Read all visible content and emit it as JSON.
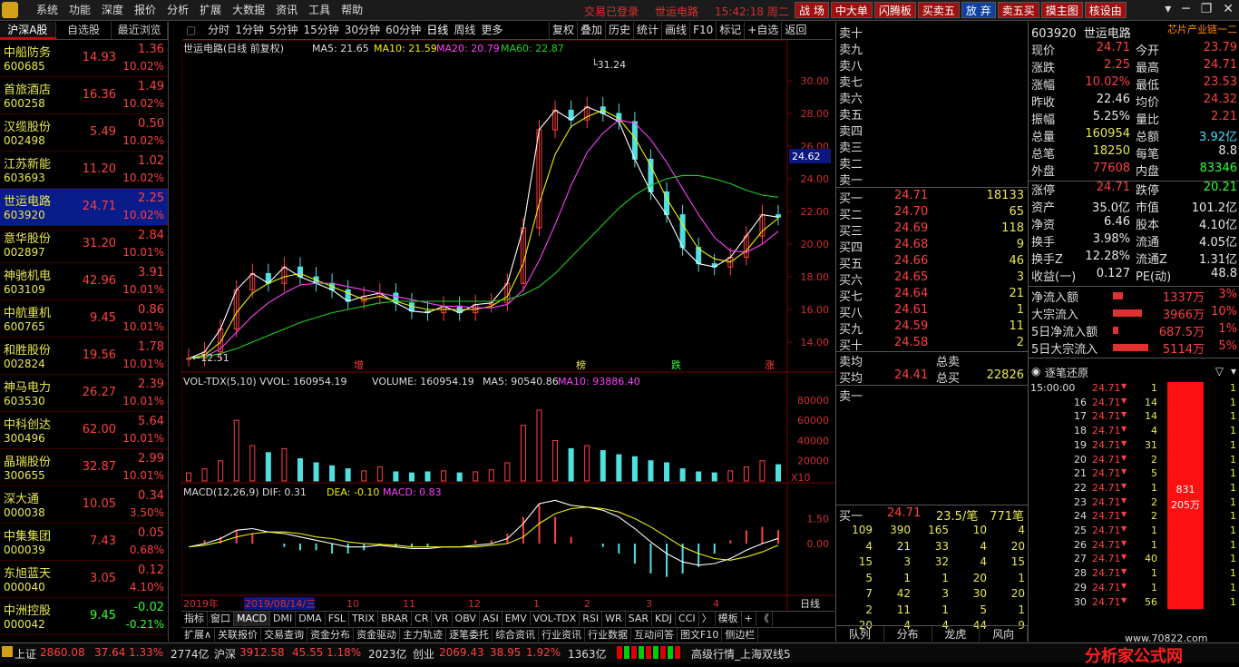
{
  "menu": {
    "items": [
      "系统",
      "功能",
      "深度",
      "报价",
      "分析",
      "扩展",
      "大数据",
      "资讯",
      "工具",
      "帮助"
    ],
    "login_status": "交易已登录",
    "stock_name": "世运电路",
    "time": "15:42:18",
    "weekday": "周二",
    "buttons": [
      "战 场",
      "中大单",
      "闪腾板",
      "买卖五",
      "放 弃",
      "卖五买",
      "摸主图",
      "核设由"
    ]
  },
  "left": {
    "tabs": [
      "沪深A股",
      "自选股",
      "最近浏览"
    ],
    "stocks": [
      {
        "name": "中船防务",
        "code": "600685",
        "price": "14.93",
        "change": "1.36",
        "pct": "10.02%"
      },
      {
        "name": "首旅酒店",
        "code": "600258",
        "price": "16.36",
        "change": "1.49",
        "pct": "10.02%"
      },
      {
        "name": "汉缆股份",
        "code": "002498",
        "price": "5.49",
        "change": "0.50",
        "pct": "10.02%"
      },
      {
        "name": "江苏新能",
        "code": "603693",
        "price": "11.20",
        "change": "1.02",
        "pct": "10.02%"
      },
      {
        "name": "世运电路",
        "code": "603920",
        "price": "24.71",
        "change": "2.25",
        "pct": "10.02%"
      },
      {
        "name": "意华股份",
        "code": "002897",
        "price": "31.20",
        "change": "2.84",
        "pct": "10.01%"
      },
      {
        "name": "神驰机电",
        "code": "603109",
        "price": "42.96",
        "change": "3.91",
        "pct": "10.01%"
      },
      {
        "name": "中航重机",
        "code": "600765",
        "price": "9.45",
        "change": "0.86",
        "pct": "10.01%"
      },
      {
        "name": "和胜股份",
        "code": "002824",
        "price": "19.56",
        "change": "1.78",
        "pct": "10.01%"
      },
      {
        "name": "神马电力",
        "code": "603530",
        "price": "26.27",
        "change": "2.39",
        "pct": "10.01%"
      },
      {
        "name": "中科创达",
        "code": "300496",
        "price": "62.00",
        "change": "5.64",
        "pct": "10.01%"
      },
      {
        "name": "晶瑞股份",
        "code": "300655",
        "price": "32.87",
        "change": "2.99",
        "pct": "10.01%"
      },
      {
        "name": "深大通",
        "code": "000038",
        "price": "10.05",
        "change": "0.34",
        "pct": "3.50%"
      },
      {
        "name": "中集集团",
        "code": "000039",
        "price": "7.43",
        "change": "0.05",
        "pct": "0.68%"
      },
      {
        "name": "东旭蓝天",
        "code": "000040",
        "price": "3.05",
        "change": "0.12",
        "pct": "4.10%"
      },
      {
        "name": "中洲控股",
        "code": "000042",
        "price": "9.45",
        "change": "-0.02",
        "pct": "-0.21%"
      }
    ]
  },
  "toolbar": {
    "periods": [
      "分时",
      "1分钟",
      "5分钟",
      "15分钟",
      "30分钟",
      "60分钟",
      "日线",
      "周线",
      "更多"
    ],
    "tools": [
      "复权",
      "叠加",
      "历史",
      "统计",
      "画线",
      "F10",
      "标记",
      "+自选",
      "返回"
    ]
  },
  "chart_labels": {
    "title": "世运电路(日线 前复权)",
    "ma5": "MA5: 21.65",
    "ma10": "MA10: 21.59",
    "ma20": "MA20: 20.79",
    "ma60": "MA60: 22.87",
    "high_mark": "31.24",
    "low_mark": "12.51",
    "current_price_tag": "24.62",
    "vol_title": "VOL-TDX(5,10)",
    "vvol": "VVOL: 160954.19",
    "volume": "VOLUME: 160954.19",
    "vol_ma5": "MA5: 90540.86",
    "vol_ma10": "MA10: 93886.40",
    "vol_unit": "X10",
    "macd_title": "MACD(12,26,9)",
    "dif": "DIF: 0.31",
    "dea": "DEA: -0.10",
    "macd": "MACD: 0.83",
    "markers": [
      "增",
      "榜",
      "跌",
      "涨"
    ],
    "date_axis": [
      "2019年",
      "2019/08/14/三",
      "10",
      "11",
      "12",
      "1",
      "2",
      "3",
      "4"
    ],
    "period_label": "日线"
  },
  "chart_data": [
    {
      "type": "line",
      "title": "世运电路(日线 前复权)",
      "ylim": [
        12.5,
        31.5
      ],
      "yticks": [
        14.0,
        16.0,
        18.0,
        20.0,
        22.0,
        24.0,
        26.0,
        28.0,
        30.0
      ],
      "series": [
        {
          "name": "MA5",
          "values": [
            13.0,
            13.4,
            14.8,
            17.2,
            18.2,
            17.6,
            18.6,
            18.0,
            17.6,
            17.2,
            16.5,
            16.8,
            17.0,
            16.4,
            15.9,
            15.8,
            16.2,
            15.8,
            16.3,
            16.4,
            17.6,
            21.0,
            27.0,
            28.2,
            27.6,
            28.4,
            28.0,
            27.5,
            25.2,
            23.2,
            21.8,
            19.8,
            18.8,
            18.6,
            19.2,
            20.5,
            21.8,
            21.65
          ]
        },
        {
          "name": "MA10",
          "values": [
            13.0,
            13.2,
            14.0,
            15.8,
            17.0,
            17.6,
            18.0,
            18.2,
            17.8,
            17.4,
            17.0,
            16.6,
            16.8,
            16.5,
            16.2,
            16.0,
            16.0,
            16.0,
            16.0,
            16.2,
            16.8,
            18.8,
            22.5,
            25.5,
            27.2,
            27.8,
            28.2,
            27.7,
            26.5,
            24.8,
            22.8,
            21.2,
            19.7,
            19.1,
            18.9,
            19.6,
            20.8,
            21.59
          ]
        },
        {
          "name": "MA20",
          "values": [
            13.0,
            13.1,
            13.6,
            14.6,
            15.6,
            16.4,
            17.0,
            17.5,
            17.6,
            17.6,
            17.4,
            17.2,
            17.0,
            16.8,
            16.6,
            16.4,
            16.2,
            16.2,
            16.1,
            16.1,
            16.3,
            17.2,
            19.0,
            21.2,
            23.6,
            25.6,
            26.8,
            27.6,
            27.4,
            26.4,
            25.0,
            23.4,
            21.8,
            20.4,
            19.6,
            19.5,
            20.0,
            20.79
          ]
        },
        {
          "name": "MA60",
          "values": [
            13.0,
            13.1,
            13.3,
            13.6,
            14.0,
            14.4,
            14.8,
            15.2,
            15.5,
            15.8,
            16.0,
            16.2,
            16.4,
            16.5,
            16.5,
            16.5,
            16.5,
            16.5,
            16.5,
            16.5,
            16.6,
            16.9,
            17.4,
            18.2,
            19.2,
            20.2,
            21.2,
            22.2,
            23.0,
            23.6,
            24.0,
            24.2,
            24.2,
            24.0,
            23.7,
            23.3,
            23.0,
            22.87
          ]
        }
      ]
    },
    {
      "type": "bar",
      "title": "VOL-TDX(5,10)",
      "ylim": [
        0,
        88000
      ],
      "yticks": [
        20000,
        40000,
        60000,
        80000
      ],
      "values": [
        8000,
        12000,
        20000,
        60000,
        35000,
        28000,
        32000,
        22000,
        18000,
        15000,
        12000,
        10000,
        14000,
        9000,
        8000,
        9000,
        10000,
        8000,
        9000,
        11000,
        18000,
        55000,
        70000,
        40000,
        32000,
        35000,
        30000,
        26000,
        24000,
        20000,
        18000,
        12000,
        9000,
        8000,
        10000,
        14000,
        20000,
        16095
      ]
    },
    {
      "type": "bar",
      "title": "MACD(12,26,9)",
      "ylim": [
        -3,
        3
      ],
      "yticks": [
        0.0,
        1.5
      ],
      "series": [
        {
          "name": "DIF",
          "values": [
            -0.2,
            0,
            0.3,
            0.8,
            0.9,
            0.7,
            0.6,
            0.4,
            0.2,
            0.0,
            -0.2,
            -0.2,
            -0.1,
            -0.2,
            -0.3,
            -0.3,
            -0.2,
            -0.2,
            -0.1,
            0.0,
            0.3,
            1.2,
            2.4,
            2.6,
            2.3,
            2.2,
            2.0,
            1.6,
            0.9,
            0.1,
            -0.6,
            -1.1,
            -1.3,
            -1.2,
            -0.9,
            -0.4,
            0.0,
            0.31
          ]
        },
        {
          "name": "DEA",
          "values": [
            -0.2,
            -0.1,
            0.1,
            0.4,
            0.6,
            0.7,
            0.7,
            0.6,
            0.4,
            0.3,
            0.1,
            0.0,
            -0.05,
            -0.1,
            -0.2,
            -0.2,
            -0.2,
            -0.2,
            -0.2,
            -0.1,
            0.0,
            0.4,
            1.2,
            1.8,
            2.1,
            2.2,
            2.1,
            1.9,
            1.5,
            1.0,
            0.4,
            -0.2,
            -0.6,
            -0.9,
            -1.0,
            -0.8,
            -0.5,
            -0.1
          ]
        }
      ]
    }
  ],
  "orderbook": {
    "sell_labels": [
      "卖十",
      "卖九",
      "卖八",
      "卖七",
      "卖六",
      "卖五",
      "卖四",
      "卖三",
      "卖二",
      "卖一"
    ],
    "buys": [
      {
        "label": "买一",
        "price": "24.71",
        "vol": "18133"
      },
      {
        "label": "买二",
        "price": "24.70",
        "vol": "65"
      },
      {
        "label": "买三",
        "price": "24.69",
        "vol": "118"
      },
      {
        "label": "买四",
        "price": "24.68",
        "vol": "9"
      },
      {
        "label": "买五",
        "price": "24.66",
        "vol": "46"
      },
      {
        "label": "买六",
        "price": "24.65",
        "vol": "3"
      },
      {
        "label": "买七",
        "price": "24.64",
        "vol": "21"
      },
      {
        "label": "买八",
        "price": "24.61",
        "vol": "1"
      },
      {
        "label": "买九",
        "price": "24.59",
        "vol": "11"
      },
      {
        "label": "买十",
        "price": "24.58",
        "vol": "2"
      }
    ],
    "sell_avg_label": "卖均",
    "buy_avg_label": "买均",
    "buy_avg": "24.41",
    "total_sell_label": "总卖",
    "total_buy_label": "总买",
    "total_buy": "22826",
    "sell1_label": "卖一",
    "queue_label": "买一",
    "queue_price": "24.71",
    "queue_per": "23.5/笔",
    "queue_count": "771笔",
    "queue_rows": [
      [
        "109",
        "390",
        "165",
        "10",
        "4"
      ],
      [
        "4",
        "21",
        "33",
        "4",
        "20"
      ],
      [
        "15",
        "3",
        "32",
        "4",
        "15"
      ],
      [
        "5",
        "1",
        "1",
        "20",
        "1"
      ],
      [
        "7",
        "42",
        "3",
        "30",
        "20"
      ],
      [
        "2",
        "11",
        "1",
        "5",
        "1"
      ],
      [
        "20",
        "4",
        "4",
        "44",
        "9"
      ]
    ]
  },
  "info": {
    "code": "603920",
    "name": "世运电路",
    "sector": "芯片产业链一二",
    "rows": [
      {
        "l1": "现价",
        "v1": "24.71",
        "c1": "red",
        "l2": "今开",
        "v2": "23.79",
        "c2": "red"
      },
      {
        "l1": "涨跌",
        "v1": "2.25",
        "c1": "red",
        "l2": "最高",
        "v2": "24.71",
        "c2": "red"
      },
      {
        "l1": "涨幅",
        "v1": "10.02%",
        "c1": "red",
        "l2": "最低",
        "v2": "23.53",
        "c2": "red"
      },
      {
        "l1": "昨收",
        "v1": "22.46",
        "c1": "wht",
        "l2": "均价",
        "v2": "24.32",
        "c2": "red"
      },
      {
        "l1": "振幅",
        "v1": "5.25%",
        "c1": "wht",
        "l2": "量比",
        "v2": "2.21",
        "c2": "red"
      },
      {
        "l1": "总量",
        "v1": "160954",
        "c1": "yel",
        "l2": "总额",
        "v2": "3.92亿",
        "c2": "cyan"
      },
      {
        "l1": "总笔",
        "v1": "18250",
        "c1": "yel",
        "l2": "每笔",
        "v2": "8.8",
        "c2": "wht"
      },
      {
        "l1": "外盘",
        "v1": "77608",
        "c1": "red",
        "l2": "内盘",
        "v2": "83346",
        "c2": "grn"
      },
      {
        "l1": "涨停",
        "v1": "24.71",
        "c1": "red",
        "l2": "跌停",
        "v2": "20.21",
        "c2": "grn"
      },
      {
        "l1": "资产",
        "v1": "35.0亿",
        "c1": "wht",
        "l2": "市值",
        "v2": "101.2亿",
        "c2": "wht"
      },
      {
        "l1": "净资",
        "v1": "6.46",
        "c1": "wht",
        "l2": "股本",
        "v2": "4.10亿",
        "c2": "wht"
      },
      {
        "l1": "换手",
        "v1": "3.98%",
        "c1": "wht",
        "l2": "流通",
        "v2": "4.05亿",
        "c2": "wht"
      },
      {
        "l1": "换手Z",
        "v1": "12.28%",
        "c1": "wht",
        "l2": "流通Z",
        "v2": "1.31亿",
        "c2": "wht"
      },
      {
        "l1": "收益(一)",
        "v1": "0.127",
        "c1": "wht",
        "l2": "PE(动)",
        "v2": "48.8",
        "c2": "wht"
      }
    ],
    "flows": [
      {
        "label": "净流入额",
        "value": "1337万",
        "pct": "3%",
        "bar": 0.15
      },
      {
        "label": "大宗流入",
        "value": "3966万",
        "pct": "10%",
        "bar": 0.45
      },
      {
        "label": "5日净流入额",
        "value": "687.5万",
        "pct": "1%",
        "bar": 0.08
      },
      {
        "label": "5日大宗流入",
        "value": "5114万",
        "pct": "5%",
        "bar": 0.55
      }
    ],
    "tick_title": "逐笔还原",
    "tick_first_time": "15:00:00",
    "ticks": [
      {
        "t": "15:00:00",
        "p": "24.71",
        "v": "1"
      },
      {
        "t": "16",
        "p": "24.71",
        "v": "14"
      },
      {
        "t": "17",
        "p": "24.71",
        "v": "14"
      },
      {
        "t": "18",
        "p": "24.71",
        "v": "4"
      },
      {
        "t": "19",
        "p": "24.71",
        "v": "31"
      },
      {
        "t": "20",
        "p": "24.71",
        "v": "2"
      },
      {
        "t": "21",
        "p": "24.71",
        "v": "5"
      },
      {
        "t": "22",
        "p": "24.71",
        "v": "1"
      },
      {
        "t": "23",
        "p": "24.71",
        "v": "2"
      },
      {
        "t": "24",
        "p": "24.71",
        "v": "2"
      },
      {
        "t": "25",
        "p": "24.71",
        "v": "1"
      },
      {
        "t": "26",
        "p": "24.71",
        "v": "1"
      },
      {
        "t": "27",
        "p": "24.71",
        "v": "40"
      },
      {
        "t": "28",
        "p": "24.71",
        "v": "1"
      },
      {
        "t": "29",
        "p": "24.71",
        "v": "1"
      },
      {
        "t": "30",
        "p": "24.71",
        "v": "56"
      }
    ],
    "bar_label1": "831",
    "bar_label2": "205万",
    "bottom_tabs": [
      "队列",
      "分布",
      "龙虎",
      "风向",
      "笔"
    ]
  },
  "bottom_tabs": {
    "row1": [
      "指标",
      "窗口",
      "MACD",
      "DMI",
      "DMA",
      "FSL",
      "TRIX",
      "BRAR",
      "CR",
      "VR",
      "OBV",
      "ASI",
      "EMV",
      "VOL-TDX",
      "RSI",
      "WR",
      "SAR",
      "KDJ",
      "CCI",
      "〉",
      "模板",
      "+",
      "《"
    ],
    "row2": [
      "扩展∧",
      "关联报价",
      "交易查询",
      "资金分布",
      "资金驱动",
      "主力轨迹",
      "逐笔委托",
      "综合资讯",
      "行业资讯",
      "行业数据",
      "互动问答",
      "图文F10",
      "侧边栏"
    ]
  },
  "status": {
    "sh_label": "上证",
    "sh_val": "2860.08",
    "sh_chg": "37.64",
    "sh_pct": "1.33%",
    "sh_amt": "2774亿",
    "sz_label": "沪深",
    "sz_val": "3912.58",
    "sz_chg": "45.55",
    "sz_pct": "1.18%",
    "sz_amt": "2023亿",
    "cy_label": "创业",
    "cy_val": "2069.43",
    "cy_chg": "38.95",
    "cy_pct": "1.92%",
    "cy_amt": "1363亿",
    "info": "高级行情_上海双线5",
    "brand": "分析家公式网",
    "site": "www.70822.com"
  }
}
